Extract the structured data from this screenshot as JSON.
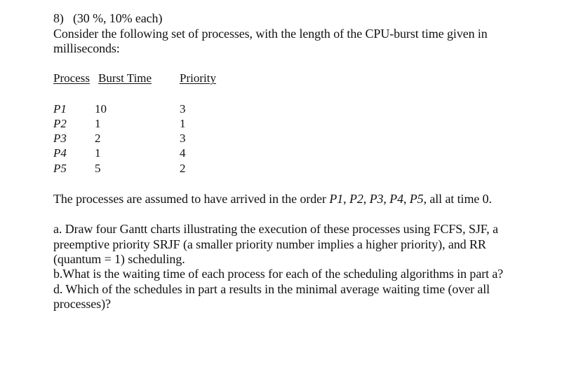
{
  "question": {
    "number": "8)",
    "marks": "(30 %, 10% each)",
    "intro_line1": "Consider the following set of processes, with the length of the CPU-burst time given in",
    "intro_line2": "milliseconds:"
  },
  "table": {
    "headers": [
      "Process",
      "Burst Time",
      "Priority"
    ],
    "rows": [
      {
        "process": "P1",
        "burst": "10",
        "priority": "3"
      },
      {
        "process": "P2",
        "burst": "1",
        "priority": "1"
      },
      {
        "process": "P3",
        "burst": "2",
        "priority": "3"
      },
      {
        "process": "P4",
        "burst": "1",
        "priority": "4"
      },
      {
        "process": "P5",
        "burst": "5",
        "priority": "2"
      }
    ]
  },
  "arrival": {
    "prefix": "The processes are assumed to have arrived in the order ",
    "order": [
      "P1",
      "P2",
      "P3",
      "P4",
      "P5"
    ],
    "suffix": ", all at time 0."
  },
  "parts": {
    "a_line1": "a. Draw four Gantt charts illustrating the execution of these processes using FCFS, SJF, a",
    "a_line2": "preemptive priority SRJF (a smaller priority number implies a higher priority), and RR",
    "a_line3": "(quantum = 1) scheduling.",
    "b": "b.What is the waiting time of each process for each of the scheduling algorithms in part a?",
    "d_line1": "d. Which of the schedules in part a results in the minimal average waiting time (over all",
    "d_line2": "processes)?"
  }
}
